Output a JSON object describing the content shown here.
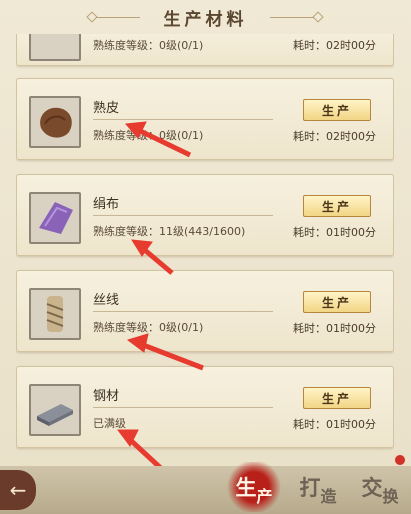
{
  "header": {
    "title": "生产材料"
  },
  "items": [
    {
      "name": "",
      "level": "熟练度等级：0级(0/1)",
      "time": "耗时：02时00分",
      "icon": "leather-scrap-icon"
    },
    {
      "name": "熟皮",
      "level": "熟练度等级：0级(0/1)",
      "time": "耗时：02时00分",
      "button": "生产",
      "icon": "cured-leather-icon"
    },
    {
      "name": "绢布",
      "level": "熟练度等级：11级(443/1600)",
      "time": "耗时：01时00分",
      "button": "生产",
      "icon": "silk-cloth-icon"
    },
    {
      "name": "丝线",
      "level": "熟练度等级：0级(0/1)",
      "time": "耗时：01时00分",
      "button": "生产",
      "icon": "silk-thread-icon"
    },
    {
      "name": "钢材",
      "level": "已满级",
      "time": "耗时：01时00分",
      "button": "生产",
      "icon": "steel-ingot-icon"
    }
  ],
  "bottom_tabs": [
    {
      "label1": "生",
      "label2": "产",
      "active": true
    },
    {
      "label1": "打",
      "label2": "造",
      "active": false
    },
    {
      "label1": "交",
      "label2": "换",
      "active": false
    }
  ],
  "colors": {
    "accent": "#b8201a",
    "button": "#f2d585",
    "annotation_arrow": "#e63b2e"
  }
}
